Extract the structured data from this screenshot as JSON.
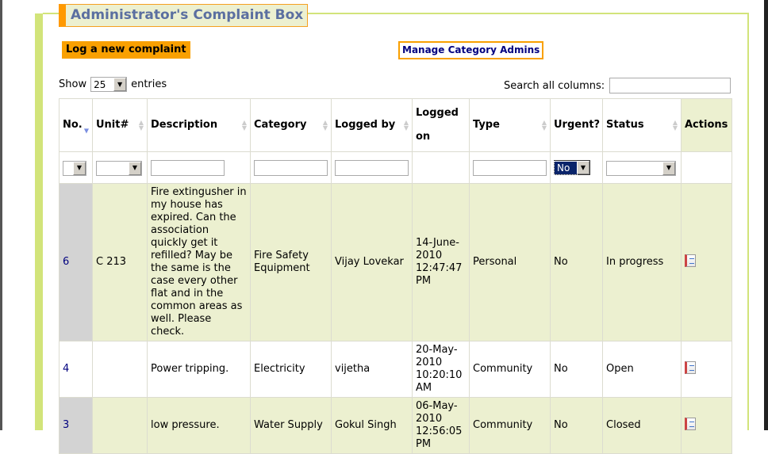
{
  "title": "Administrator's Complaint Box",
  "log_button": "Log a new complaint",
  "manage_link": "Manage Category Admins",
  "length": {
    "show": "Show",
    "value": "25",
    "entries": "entries"
  },
  "search": {
    "label": "Search all columns:",
    "value": ""
  },
  "columns": [
    "No.",
    "Unit#",
    "Description",
    "Category",
    "Logged by",
    "Logged on",
    "Type",
    "Urgent?",
    "Status",
    "Actions"
  ],
  "filters": {
    "urgent": "No"
  },
  "rows": [
    {
      "no": "6",
      "unit": "C 213",
      "description": "Fire extingusher in my house has expired. Can the association quickly get it refilled? May be the same is the case every other flat and in the common areas as well. Please check.",
      "category": "Fire Safety Equipment",
      "logged_by": "Vijay Lovekar",
      "logged_on": "14-June-2010 12:47:47 PM",
      "type": "Personal",
      "urgent": "No",
      "status": "In progress"
    },
    {
      "no": "4",
      "unit": "",
      "description": "Power tripping.",
      "category": "Electricity",
      "logged_by": "vijetha",
      "logged_on": "20-May-2010 10:20:10 AM",
      "type": "Community",
      "urgent": "No",
      "status": "Open"
    },
    {
      "no": "3",
      "unit": "",
      "description": "low pressure.",
      "category": "Water Supply",
      "logged_by": "Gokul Singh",
      "logged_on": "06-May-2010 12:56:05 PM",
      "type": "Community",
      "urgent": "No",
      "status": "Closed"
    }
  ]
}
